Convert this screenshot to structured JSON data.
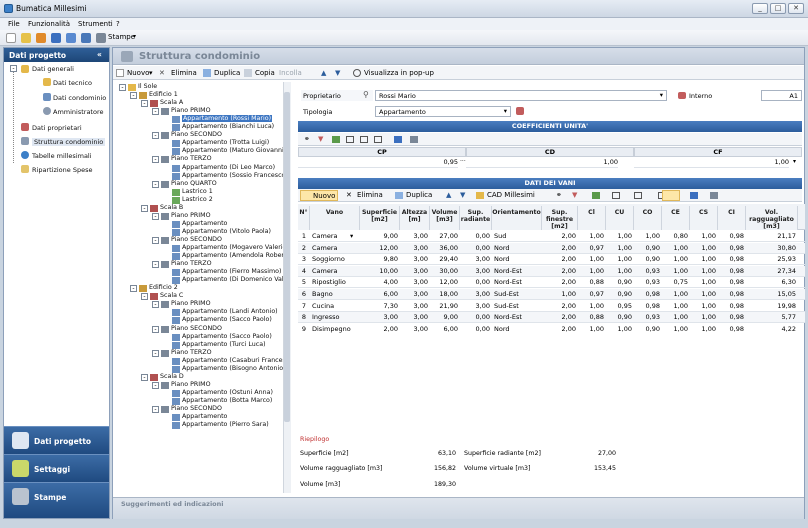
{
  "app": {
    "title": "Bumatica Millesimi",
    "win_min": "_",
    "win_max": "□",
    "win_close": "✕"
  },
  "menu": [
    "File",
    "Funzionalità",
    "Strumenti",
    "?"
  ],
  "toolbar": {
    "print_label": "Stampe"
  },
  "nav": {
    "header": "Dati progetto",
    "collapse": "«",
    "items": [
      {
        "label": "Dati generali"
      },
      {
        "label": "Dati tecnico"
      },
      {
        "label": "Dati condominio"
      },
      {
        "label": "Amministratore"
      },
      {
        "label": "Dati proprietari"
      },
      {
        "label": "Struttura condominio"
      },
      {
        "label": "Tabelle millesimali"
      },
      {
        "label": "Ripartizione Spese"
      }
    ],
    "big": [
      {
        "label": "Dati progetto"
      },
      {
        "label": "Settaggi"
      },
      {
        "label": "Stampe"
      }
    ]
  },
  "main": {
    "title": "Struttura condominio",
    "actions": {
      "nuovo": "Nuovo",
      "elimina": "Elimina",
      "duplica": "Duplica",
      "copia": "Copia",
      "incolla": "Incolla",
      "popup": "Visualizza in pop-up"
    }
  },
  "tree": [
    {
      "t": "Il Sole",
      "l": 0
    },
    {
      "t": "Edificio 1",
      "l": 1
    },
    {
      "t": "Scala A",
      "l": 2
    },
    {
      "t": "Piano PRIMO",
      "l": 3
    },
    {
      "t": "Appartamento (Rossi Mario)",
      "l": 4,
      "sel": true
    },
    {
      "t": "Appartamento (Bianchi Luca)",
      "l": 4
    },
    {
      "t": "Piano SECONDO",
      "l": 3
    },
    {
      "t": "Appartamento (Trotta Luigi)",
      "l": 4
    },
    {
      "t": "Appartamento (Maturo Giovanni)",
      "l": 4
    },
    {
      "t": "Piano TERZO",
      "l": 3
    },
    {
      "t": "Appartamento (Di Leo Marco)",
      "l": 4
    },
    {
      "t": "Appartamento (Sossio Francesco)",
      "l": 4
    },
    {
      "t": "Piano QUARTO",
      "l": 3
    },
    {
      "t": "Lastrico 1",
      "l": 4
    },
    {
      "t": "Lastrico 2",
      "l": 4
    },
    {
      "t": "Scala B",
      "l": 2
    },
    {
      "t": "Piano PRIMO",
      "l": 3
    },
    {
      "t": "Appartamento",
      "l": 4
    },
    {
      "t": "Appartamento (Vitolo Paola)",
      "l": 4
    },
    {
      "t": "Piano SECONDO",
      "l": 3
    },
    {
      "t": "Appartamento (Mogavero Valerio)",
      "l": 4
    },
    {
      "t": "Appartamento (Amendola Roberto)",
      "l": 4
    },
    {
      "t": "Piano TERZO",
      "l": 3
    },
    {
      "t": "Appartamento (Fierro Massimo)",
      "l": 4
    },
    {
      "t": "Appartamento (Di Domenico Valerio)",
      "l": 4
    },
    {
      "t": "Edificio 2",
      "l": 1
    },
    {
      "t": "Scala C",
      "l": 2
    },
    {
      "t": "Piano PRIMO",
      "l": 3
    },
    {
      "t": "Appartamento (Landi Antonio)",
      "l": 4
    },
    {
      "t": "Appartamento (Sacco Paolo)",
      "l": 4
    },
    {
      "t": "Piano SECONDO",
      "l": 3
    },
    {
      "t": "Appartamento (Sacco Paolo)",
      "l": 4
    },
    {
      "t": "Appartamento (Turci Luca)",
      "l": 4
    },
    {
      "t": "Piano TERZO",
      "l": 3
    },
    {
      "t": "Appartamento (Casaburi Francesco)",
      "l": 4
    },
    {
      "t": "Appartamento (Bisogno Antonio)",
      "l": 4
    },
    {
      "t": "Scala D",
      "l": 2
    },
    {
      "t": "Piano PRIMO",
      "l": 3
    },
    {
      "t": "Appartamento (Ostuni Anna)",
      "l": 4
    },
    {
      "t": "Appartamento (Botta Marco)",
      "l": 4
    },
    {
      "t": "Piano SECONDO",
      "l": 3
    },
    {
      "t": "Appartamento",
      "l": 4
    },
    {
      "t": "Appartamento (Pierro Sara)",
      "l": 4
    }
  ],
  "props": {
    "proprietario_label": "Proprietario",
    "proprietario": "Rossi Mario",
    "interno_label": "Interno",
    "interno": "A1",
    "tipologia_label": "Tipologia",
    "tipologia": "Appartamento"
  },
  "coeff": {
    "title": "COEFFICIENTI UNITA'",
    "headers": [
      "CP",
      "CD",
      "CF"
    ],
    "values": [
      "0,95",
      "1,00",
      "1,00"
    ]
  },
  "vani": {
    "title": "DATI DEI VANI",
    "tb": {
      "nuovo": "Nuovo",
      "elimina": "Elimina",
      "duplica": "Duplica",
      "cad": "CAD Millesimi"
    },
    "headers": [
      "N°",
      "Vano",
      "Superficie [m2]",
      "Altezza [m]",
      "Volume [m3]",
      "Sup. radiante",
      "Orientamento",
      "Sup. finestre [m2]",
      "Cl",
      "CU",
      "CO",
      "CE",
      "CS",
      "CI",
      "Vol. ragguagliato [m3]"
    ],
    "rows": [
      [
        "1",
        "Camera",
        "9,00",
        "3,00",
        "27,00",
        "0,00",
        "Sud",
        "2,00",
        "1,00",
        "1,00",
        "1,00",
        "0,80",
        "1,00",
        "0,98",
        "21,17"
      ],
      [
        "2",
        "Camera",
        "12,00",
        "3,00",
        "36,00",
        "0,00",
        "Nord",
        "2,00",
        "0,97",
        "1,00",
        "0,90",
        "1,00",
        "1,00",
        "0,98",
        "30,80"
      ],
      [
        "3",
        "Soggiorno",
        "9,80",
        "3,00",
        "29,40",
        "3,00",
        "Nord",
        "2,00",
        "1,00",
        "1,00",
        "0,90",
        "1,00",
        "1,00",
        "0,98",
        "25,93"
      ],
      [
        "4",
        "Camera",
        "10,00",
        "3,00",
        "30,00",
        "3,00",
        "Nord-Est",
        "2,00",
        "1,00",
        "1,00",
        "0,93",
        "1,00",
        "1,00",
        "0,98",
        "27,34"
      ],
      [
        "5",
        "Ripostiglio",
        "4,00",
        "3,00",
        "12,00",
        "0,00",
        "Nord-Est",
        "2,00",
        "0,88",
        "0,90",
        "0,93",
        "0,75",
        "1,00",
        "0,98",
        "6,30"
      ],
      [
        "6",
        "Bagno",
        "6,00",
        "3,00",
        "18,00",
        "3,00",
        "Sud-Est",
        "1,00",
        "0,97",
        "0,90",
        "0,98",
        "1,00",
        "1,00",
        "0,98",
        "15,05"
      ],
      [
        "7",
        "Cucina",
        "7,30",
        "3,00",
        "21,90",
        "3,00",
        "Sud-Est",
        "2,00",
        "1,00",
        "0,95",
        "0,98",
        "1,00",
        "1,00",
        "0,98",
        "19,98"
      ],
      [
        "8",
        "Ingresso",
        "3,00",
        "3,00",
        "9,00",
        "0,00",
        "Nord-Est",
        "2,00",
        "0,88",
        "0,90",
        "0,93",
        "1,00",
        "1,00",
        "0,98",
        "5,77"
      ],
      [
        "9",
        "Disimpegno",
        "2,00",
        "3,00",
        "6,00",
        "0,00",
        "Nord",
        "2,00",
        "1,00",
        "1,00",
        "0,90",
        "1,00",
        "1,00",
        "0,98",
        "4,22"
      ]
    ]
  },
  "riepilogo": {
    "title": "Riepilogo",
    "sup_label": "Superficie [m2]",
    "sup": "63,10",
    "volr_label": "Volume ragguagliato [m3]",
    "volr": "156,82",
    "vol_label": "Volume [m3]",
    "vol": "189,30",
    "srad_label": "Superficie radiante [m2]",
    "srad": "27,00",
    "volv_label": "Volume virtuale [m3]",
    "volv": "153,45"
  },
  "suggerimenti": "Suggerimenti ed indicazioni"
}
